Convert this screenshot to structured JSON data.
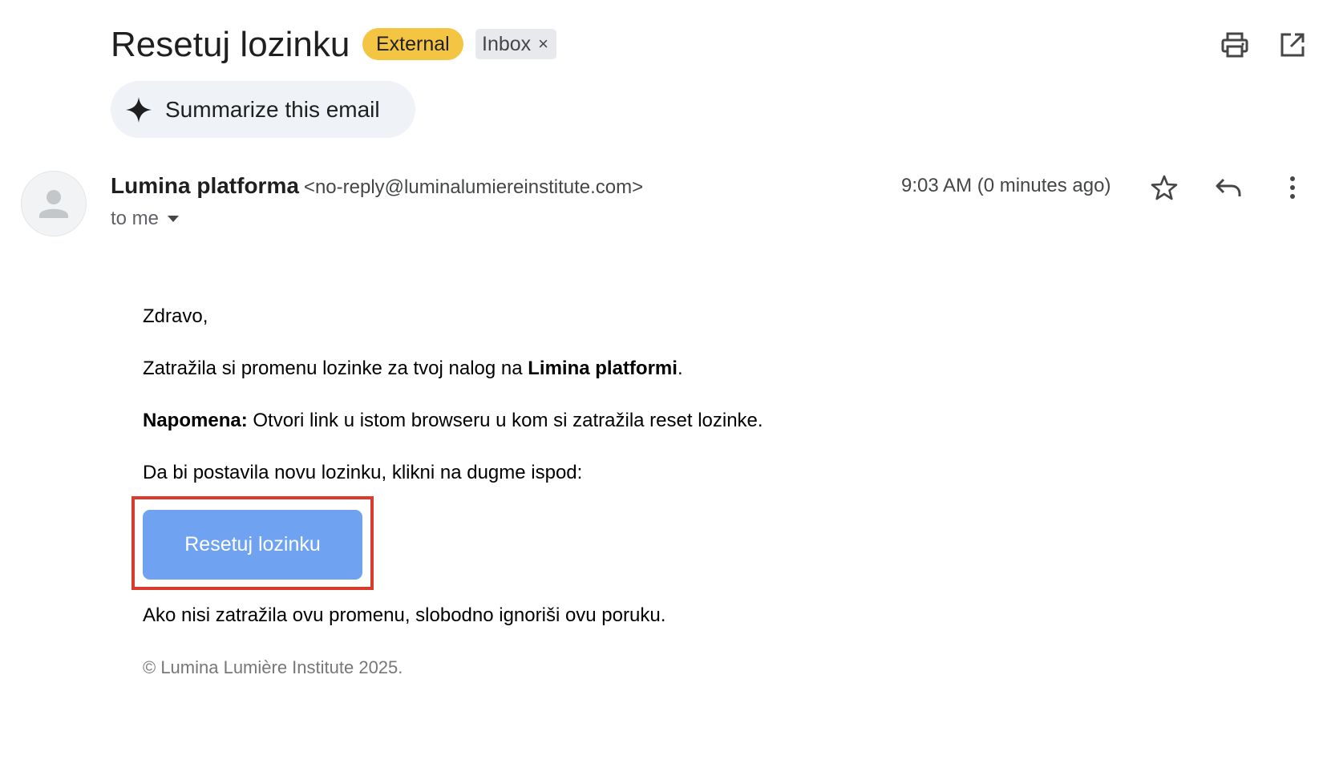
{
  "header": {
    "subject": "Resetuj lozinku",
    "external_label": "External",
    "inbox_label": "Inbox",
    "inbox_close": "×"
  },
  "summarize": {
    "label": "Summarize this email"
  },
  "sender": {
    "name": "Lumina platforma",
    "email": "<no-reply@luminalumiereinstitute.com>",
    "to_label": "to me",
    "timestamp": "9:03 AM (0 minutes ago)"
  },
  "body": {
    "greeting": "Zdravo,",
    "p1_prefix": "Zatražila si promenu lozinke za tvoj nalog na ",
    "p1_bold": "Limina platformi",
    "p1_suffix": ".",
    "p2_bold": "Napomena:",
    "p2_text": " Otvori link u istom browseru u kom si zatražila reset lozinke.",
    "p3": "Da bi postavila novu lozinku, klikni na dugme ispod:",
    "button_label": "Resetuj lozinku",
    "p4": "Ako nisi zatražila ovu promenu, slobodno ignoriši ovu poruku.",
    "copyright": "© Lumina Lumière Institute 2025."
  },
  "icons": {
    "print": "print-icon",
    "open_new_window": "open-in-new-window-icon",
    "sparkle": "sparkle-icon",
    "avatar": "person-avatar-icon",
    "dropdown": "caret-down-icon",
    "star": "star-icon",
    "reply": "reply-icon",
    "more": "more-vertical-icon"
  },
  "colors": {
    "external_badge": "#f4c542",
    "inbox_badge": "#e7e9ec",
    "button": "#6fa3f2",
    "highlight_border": "#d93c2f",
    "summarize_chip": "#eff2f6"
  }
}
